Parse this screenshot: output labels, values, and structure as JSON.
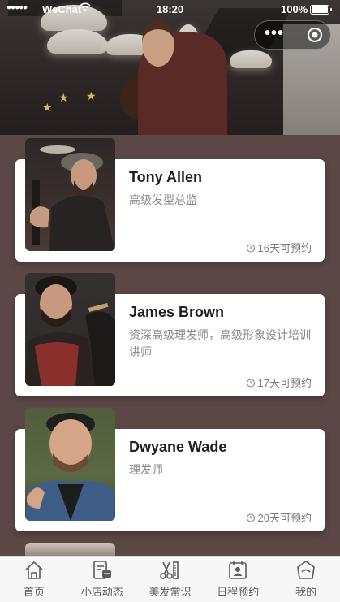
{
  "status_bar": {
    "carrier": "WeChat",
    "time": "18:20",
    "battery": "100%"
  },
  "barbers": [
    {
      "name": "Tony Allen",
      "title": "高级发型总监",
      "availability": "16天可预约"
    },
    {
      "name": "James Brown",
      "title": "资深高级理发师，高级形象设计培训讲师",
      "availability": "17天可预约"
    },
    {
      "name": "Dwyane Wade",
      "title": "理发师",
      "availability": "20天可预约"
    }
  ],
  "tabbar": [
    {
      "label": "首页",
      "icon": "home-icon"
    },
    {
      "label": "小店动态",
      "icon": "store-news-icon"
    },
    {
      "label": "美发常识",
      "icon": "scissors-comb-icon"
    },
    {
      "label": "日程预约",
      "icon": "calendar-profile-icon"
    },
    {
      "label": "我的",
      "icon": "profile-icon"
    }
  ]
}
